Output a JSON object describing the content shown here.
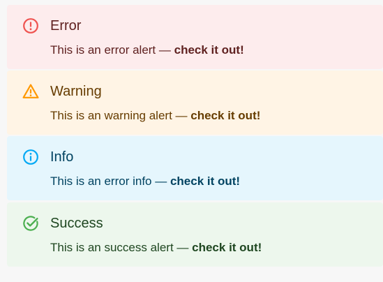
{
  "alerts": [
    {
      "severity": "error",
      "title": "Error",
      "message": "This is an error alert —",
      "emphasis": "check it out!",
      "icon": "error-outline-icon",
      "icon_color": "#ef5350",
      "background": "#fdeced",
      "text_color": "#5f2120"
    },
    {
      "severity": "warning",
      "title": "Warning",
      "message": "This is an warning alert —",
      "emphasis": "check it out!",
      "icon": "warning-triangle-icon",
      "icon_color": "#ff9800",
      "background": "#fff4e5",
      "text_color": "#663c00"
    },
    {
      "severity": "info",
      "title": "Info",
      "message": "This is an error info —",
      "emphasis": "check it out!",
      "icon": "info-outline-icon",
      "icon_color": "#03a9f4",
      "background": "#e5f6fd",
      "text_color": "#014361"
    },
    {
      "severity": "success",
      "title": "Success",
      "message": "This is an success alert —",
      "emphasis": "check it out!",
      "icon": "check-circle-outline-icon",
      "icon_color": "#4caf50",
      "background": "#edf7ed",
      "text_color": "#1e4620"
    }
  ]
}
